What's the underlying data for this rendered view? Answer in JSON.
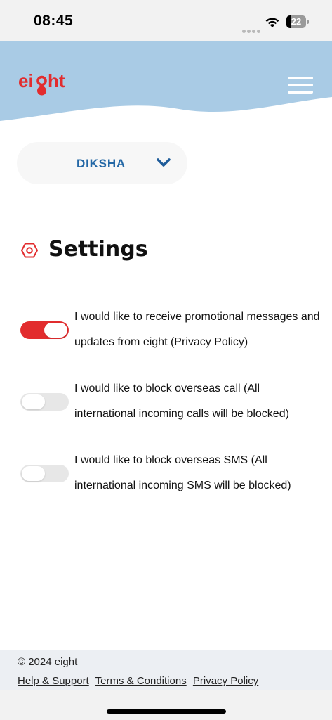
{
  "status_bar": {
    "time": "08:45",
    "battery_level": "22"
  },
  "brand": {
    "logo_text": "eight",
    "primary_color": "#e22c2e",
    "header_color": "#a9cbe5"
  },
  "account": {
    "name": "DIKSHA"
  },
  "page": {
    "title": "Settings"
  },
  "settings": [
    {
      "label": "I would like to receive promotional messages and updates from eight (Privacy Policy)",
      "enabled": true
    },
    {
      "label": "I would like to block overseas call (All international incoming calls will be blocked)",
      "enabled": false
    },
    {
      "label": "I would like to block overseas SMS (All international incoming SMS will be blocked)",
      "enabled": false
    }
  ],
  "footer": {
    "copyright": "© 2024 eight",
    "links": [
      "Help & Support",
      "Terms & Conditions",
      "Privacy Policy"
    ]
  },
  "icons": {
    "menu": "hamburger-menu-icon",
    "chevron": "chevron-down-icon",
    "settings": "hexagon-settings-icon"
  }
}
